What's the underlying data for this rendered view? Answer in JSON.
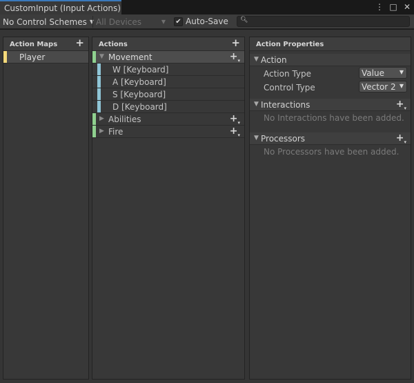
{
  "window": {
    "tab_title": "CustomInput (Input Actions)",
    "menu_icon": "⋮",
    "maximize_icon": "□",
    "close_icon": "✕"
  },
  "toolbar": {
    "control_schemes": "No Control Schemes",
    "devices": "All Devices",
    "auto_save_label": "Auto-Save",
    "auto_save_checked": true,
    "search_value": ""
  },
  "action_maps": {
    "header": "Action Maps",
    "items": [
      {
        "label": "Player",
        "color": "#f4d97a"
      }
    ]
  },
  "actions": {
    "header": "Actions",
    "items": [
      {
        "label": "Movement",
        "expanded": true,
        "selected": true,
        "color": "#8fd08f",
        "bindings": [
          {
            "label": "W [Keyboard]",
            "color": "#8fc5d6"
          },
          {
            "label": "A [Keyboard]",
            "color": "#8fc5d6"
          },
          {
            "label": "S [Keyboard]",
            "color": "#8fc5d6"
          },
          {
            "label": "D [Keyboard]",
            "color": "#8fc5d6"
          }
        ]
      },
      {
        "label": "Abilities",
        "expanded": false,
        "color": "#8fd08f"
      },
      {
        "label": "Fire",
        "expanded": false,
        "color": "#8fd08f"
      }
    ]
  },
  "properties": {
    "header": "Action Properties",
    "action_section": "Action",
    "action_type_label": "Action Type",
    "action_type_value": "Value",
    "control_type_label": "Control Type",
    "control_type_value": "Vector 2",
    "interactions_section": "Interactions",
    "interactions_empty": "No Interactions have been added.",
    "processors_section": "Processors",
    "processors_empty": "No Processors have been added."
  }
}
